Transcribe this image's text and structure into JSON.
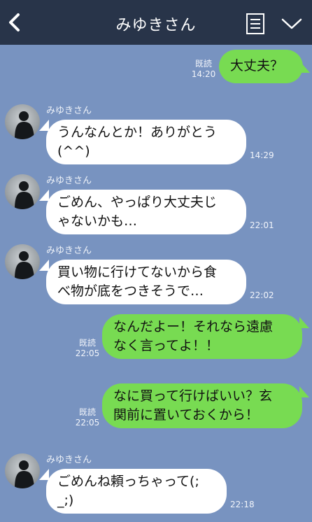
{
  "header": {
    "title": "みゆきさん",
    "back_icon": "chevron-left-icon",
    "menu_icon": "note-list-icon",
    "collapse_icon": "chevron-down-icon"
  },
  "colors": {
    "background": "#7893c0",
    "header": "#283449",
    "sent_bubble": "#78db52",
    "received_bubble": "#ffffff"
  },
  "messages": [
    {
      "side": "sent",
      "text": "大丈夫？",
      "read_label": "既読",
      "time": "14:20"
    },
    {
      "side": "received",
      "sender": "みゆきさん",
      "text": "うんなんとか！ありがとう\n(^^)",
      "time": "14:29"
    },
    {
      "side": "received",
      "sender": "みゆきさん",
      "text": "ごめん、やっぱり大丈夫じ\nゃないかも…",
      "time": "22:01"
    },
    {
      "side": "received",
      "sender": "みゆきさん",
      "text": "買い物に行けてないから食\nべ物が底をつきそうで…",
      "time": "22:02"
    },
    {
      "side": "sent",
      "text": "なんだよー！それなら遠慮\nなく言ってよ！！",
      "read_label": "既読",
      "time": "22:05"
    },
    {
      "side": "sent",
      "text": "なに買って行けばいい？玄\n関前に置いておくから！",
      "read_label": "既読",
      "time": "22:05"
    },
    {
      "side": "received",
      "sender": "みゆきさん",
      "text": "ごめんね頼っちゃって(;\n_;)",
      "time": "22:18"
    }
  ]
}
